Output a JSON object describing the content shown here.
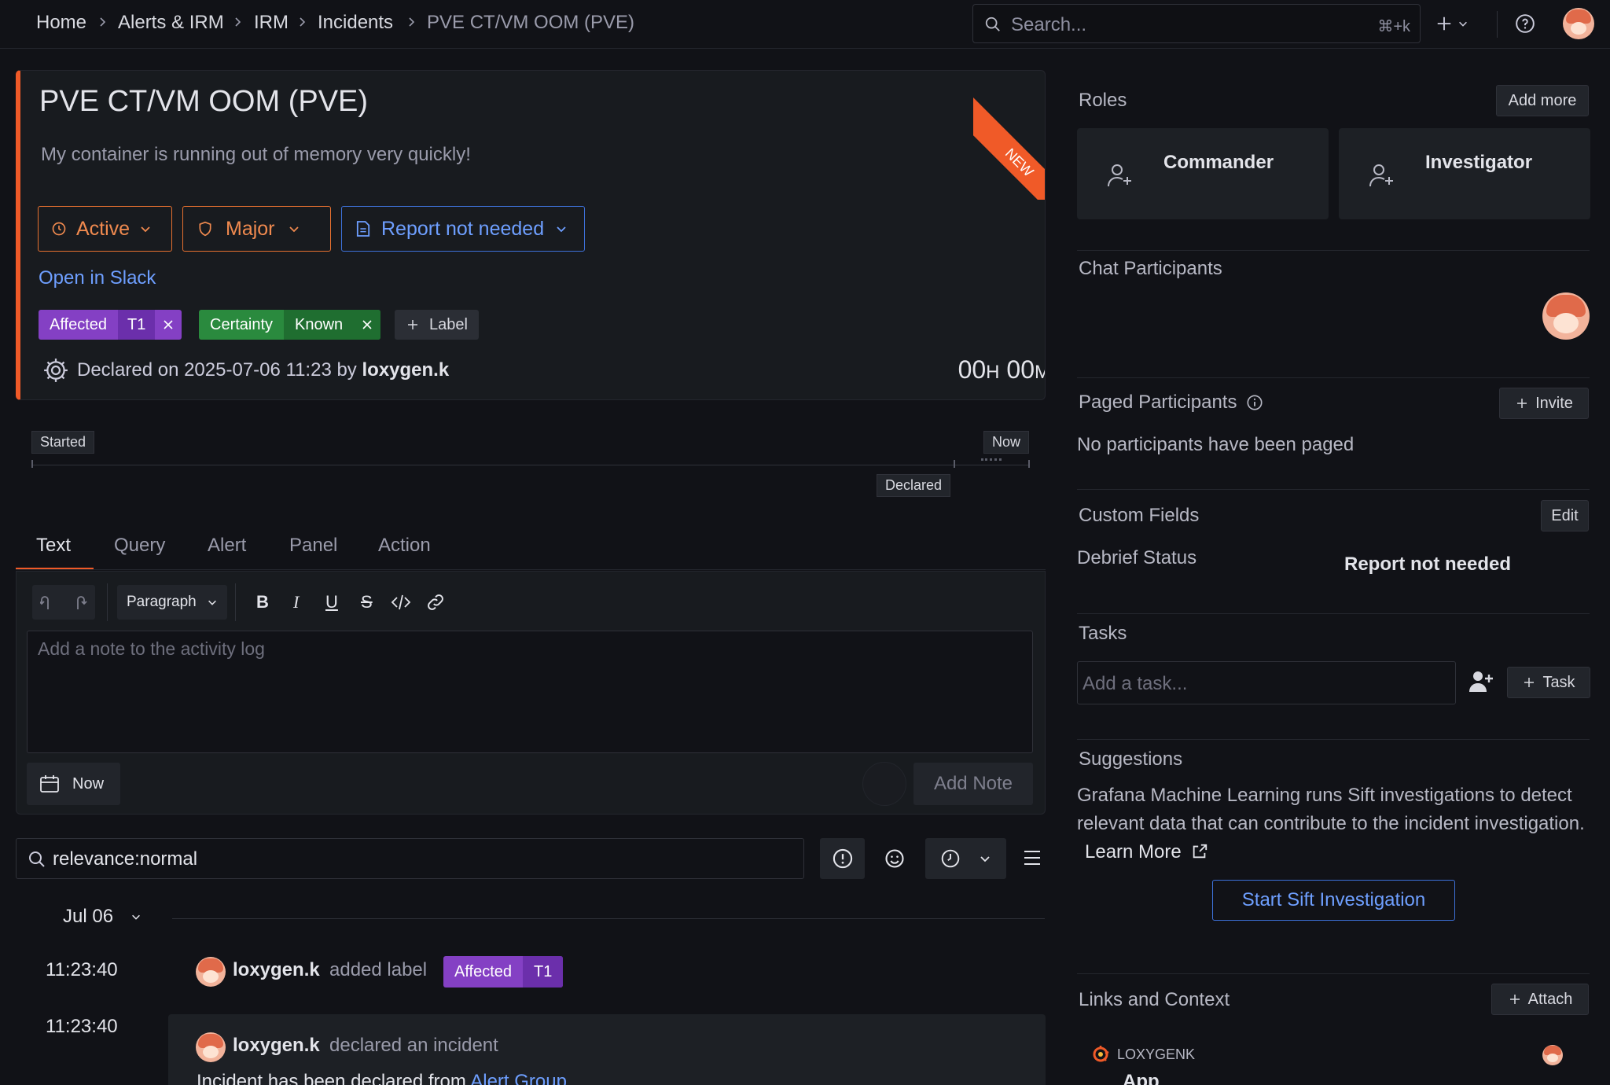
{
  "breadcrumbs": [
    "Home",
    "Alerts & IRM",
    "IRM",
    "Incidents",
    "PVE CT/VM OOM (PVE)"
  ],
  "search": {
    "placeholder": "Search...",
    "shortcut": "⌘+k"
  },
  "incident": {
    "title": "PVE CT/VM OOM (PVE)",
    "ribbon": "NEW",
    "description": "My container is running out of memory very quickly!",
    "status": "Active",
    "severity": "Major",
    "report": "Report not needed",
    "slack_link": "Open in Slack",
    "labels": [
      {
        "key": "Affected",
        "value": "T1",
        "color": "#8440c4",
        "value_color": "#6b2fab"
      },
      {
        "key": "Certainty",
        "value": "Known",
        "color": "#2a8a3e",
        "value_color": "#1f6e30"
      }
    ],
    "add_label": "Label",
    "declared_prefix": "Declared on 2025-07-06 11:23 by",
    "declared_by": "loxygen.k",
    "elapsed": {
      "hours": "00",
      "h_unit": "H",
      "minutes": "00",
      "m_unit": "M"
    }
  },
  "timeline": {
    "start": "Started",
    "now": "Now",
    "declared": "Declared"
  },
  "tabs": [
    "Text",
    "Query",
    "Alert",
    "Panel",
    "Action"
  ],
  "editor": {
    "paragraph": "Paragraph",
    "placeholder": "Add a note to the activity log",
    "time_button": "Now",
    "add_note": "Add Note"
  },
  "filter": {
    "value": "relevance:normal"
  },
  "activity": {
    "date": "Jul 06",
    "entries": [
      {
        "time": "11:23:40",
        "user": "loxygen.k",
        "action": "added label",
        "label_key": "Affected",
        "label_value": "T1"
      },
      {
        "time": "11:23:40",
        "user": "loxygen.k",
        "action": "declared an incident",
        "body_prefix": "Incident has been declared from",
        "body_link": "Alert Group"
      }
    ]
  },
  "sidebar": {
    "roles": {
      "title": "Roles",
      "add_more": "Add more",
      "items": [
        "Commander",
        "Investigator"
      ]
    },
    "chat": {
      "title": "Chat Participants"
    },
    "paged": {
      "title": "Paged Participants",
      "invite": "Invite",
      "empty": "No participants have been paged"
    },
    "custom_fields": {
      "title": "Custom Fields",
      "edit": "Edit",
      "field_name": "Debrief Status",
      "field_value": "Report not needed"
    },
    "tasks": {
      "title": "Tasks",
      "placeholder": "Add a task...",
      "task_button": "Task"
    },
    "suggestions": {
      "title": "Suggestions",
      "text": "Grafana Machine Learning runs Sift investigations to detect relevant data that can contribute to the incident investigation.",
      "learn_more": "Learn More",
      "start_button": "Start Sift Investigation"
    },
    "links": {
      "title": "Links and Context",
      "attach": "Attach",
      "source": "LOXYGENK",
      "app": "App"
    }
  },
  "colors": {
    "accent_orange": "#f05a28",
    "link_blue": "#6e9fff",
    "purple": "#8440c4",
    "green": "#2a8a3e"
  }
}
